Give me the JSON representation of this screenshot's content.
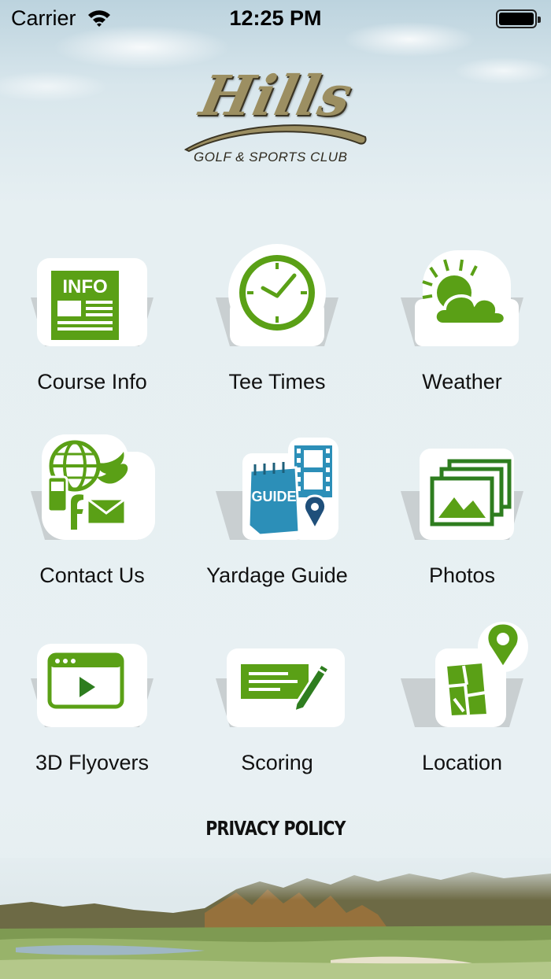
{
  "status_bar": {
    "carrier": "Carrier",
    "time": "12:25 PM"
  },
  "logo": {
    "wordmark": "Hills",
    "subtitle": "GOLF & SPORTS CLUB"
  },
  "menu": [
    {
      "label": "Course Info",
      "icon": "info-newspaper-icon"
    },
    {
      "label": "Tee Times",
      "icon": "clock-icon"
    },
    {
      "label": "Weather",
      "icon": "sun-cloud-icon"
    },
    {
      "label": "Contact Us",
      "icon": "contact-globe-icon"
    },
    {
      "label": "Yardage Guide",
      "icon": "yardage-guide-icon"
    },
    {
      "label": "Photos",
      "icon": "photos-icon"
    },
    {
      "label": "3D Flyovers",
      "icon": "video-player-icon"
    },
    {
      "label": "Scoring",
      "icon": "scorecard-pencil-icon"
    },
    {
      "label": "Location",
      "icon": "map-pin-icon"
    }
  ],
  "icon_text": {
    "info": "INFO",
    "guide": "GUIDE"
  },
  "footer": {
    "privacy_label": "PRIVACY POLICY"
  },
  "colors": {
    "brand_green": "#5aa016",
    "guide_blue": "#2c8fb8",
    "logo_gold": "#9c8f62",
    "background": "#e6eff2"
  }
}
